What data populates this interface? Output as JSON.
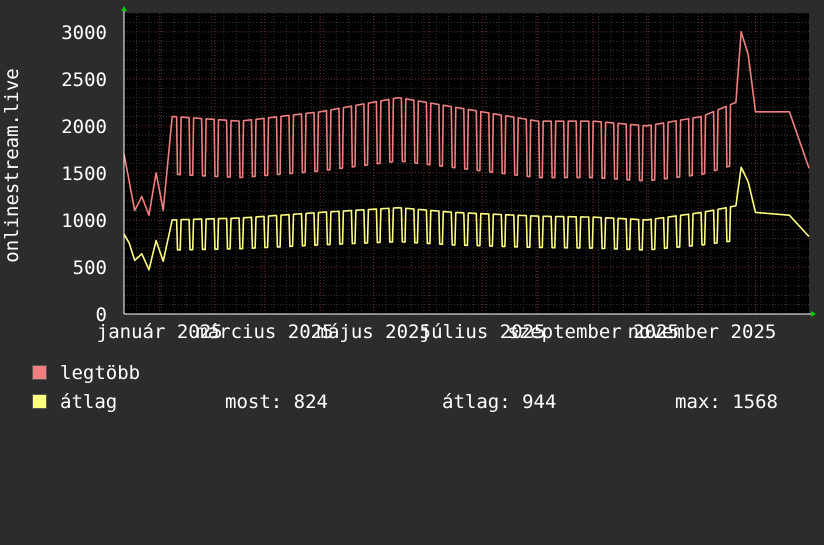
{
  "chart_data": {
    "type": "line",
    "ylabel": "onlinestream.live",
    "ylim": [
      0,
      3200
    ],
    "y_ticks": [
      0,
      500,
      1000,
      1500,
      2000,
      2500,
      3000
    ],
    "y_tick_labels": [
      "0",
      "500",
      "1000",
      "1500",
      "2000",
      "2500",
      "3000"
    ],
    "x_range": [
      "2024-12-12",
      "2025-12-31"
    ],
    "x_tick_labels": [
      "január 2025",
      "március 2025",
      "május 2025",
      "július 2025",
      "szeptember 2025",
      "november 2025"
    ],
    "grid": true,
    "series": [
      {
        "name": "legtöbb",
        "color": "#f08080",
        "pattern": {
          "weekday_high": 2050,
          "weekend_low": 1450
        },
        "anchors": [
          [
            "2024-12-12",
            1700
          ],
          [
            "2024-12-15",
            1400
          ],
          [
            "2024-12-18",
            1100
          ],
          [
            "2024-12-22",
            1250
          ],
          [
            "2024-12-26",
            1050
          ],
          [
            "2024-12-30",
            1500
          ],
          [
            "2025-01-03",
            1100
          ],
          [
            "2025-01-08",
            2100
          ],
          [
            "2025-02-15",
            2050
          ],
          [
            "2025-04-01",
            2150
          ],
          [
            "2025-05-15",
            2300
          ],
          [
            "2025-06-15",
            2200
          ],
          [
            "2025-08-01",
            2050
          ],
          [
            "2025-09-01",
            2050
          ],
          [
            "2025-10-01",
            2000
          ],
          [
            "2025-11-01",
            2100
          ],
          [
            "2025-11-20",
            2250
          ],
          [
            "2025-11-23",
            3000
          ],
          [
            "2025-11-27",
            2750
          ],
          [
            "2025-12-01",
            2150
          ],
          [
            "2025-12-20",
            2150
          ],
          [
            "2025-12-31",
            1550
          ]
        ]
      },
      {
        "name": "átlag",
        "color": "#ffff80",
        "pattern": {
          "weekday_high": 1000,
          "weekend_low": 680
        },
        "anchors": [
          [
            "2024-12-12",
            850
          ],
          [
            "2024-12-15",
            750
          ],
          [
            "2024-12-18",
            570
          ],
          [
            "2024-12-22",
            640
          ],
          [
            "2024-12-26",
            470
          ],
          [
            "2024-12-30",
            780
          ],
          [
            "2025-01-03",
            560
          ],
          [
            "2025-01-08",
            1000
          ],
          [
            "2025-02-15",
            1020
          ],
          [
            "2025-04-01",
            1080
          ],
          [
            "2025-05-15",
            1130
          ],
          [
            "2025-06-15",
            1080
          ],
          [
            "2025-08-01",
            1040
          ],
          [
            "2025-09-01",
            1030
          ],
          [
            "2025-10-01",
            1000
          ],
          [
            "2025-11-01",
            1080
          ],
          [
            "2025-11-20",
            1150
          ],
          [
            "2025-11-23",
            1560
          ],
          [
            "2025-11-27",
            1400
          ],
          [
            "2025-12-01",
            1080
          ],
          [
            "2025-12-20",
            1050
          ],
          [
            "2025-12-31",
            824
          ]
        ]
      }
    ]
  },
  "legend": [
    {
      "label": "legtöbb",
      "color": "#f08080"
    },
    {
      "label": "átlag",
      "color": "#ffff80"
    }
  ],
  "stats": {
    "now": "most: 824",
    "avg": "átlag: 944",
    "max": "max: 1568"
  },
  "colors": {
    "background": "#2c2c2c",
    "plot_background": "#000000",
    "grid_minor": "#3a3a3a",
    "grid_major": "#7a3030",
    "axis": "#ffffff",
    "arrow": "#00cc00"
  }
}
